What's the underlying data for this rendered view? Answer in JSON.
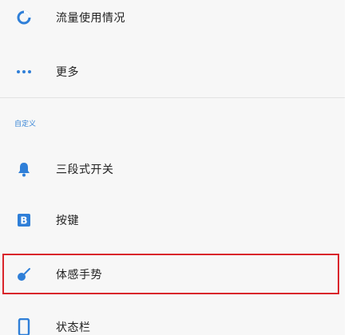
{
  "settings_list": {
    "items": [
      {
        "label": "流量使用情况",
        "icon": "data-usage-icon"
      },
      {
        "label": "更多",
        "icon": "more-dots-icon"
      }
    ],
    "section_header": "自定义",
    "custom_items": [
      {
        "label": "三段式开关",
        "icon": "bell-icon"
      },
      {
        "label": "按键",
        "icon": "b-key-icon"
      },
      {
        "label": "体感手势",
        "icon": "gesture-icon",
        "highlighted": true
      },
      {
        "label": "状态栏",
        "icon": "phone-icon"
      }
    ]
  },
  "colors": {
    "accent": "#3a86d6",
    "highlight_border": "#d9252b",
    "icon_blue": "#2f7fd8"
  }
}
